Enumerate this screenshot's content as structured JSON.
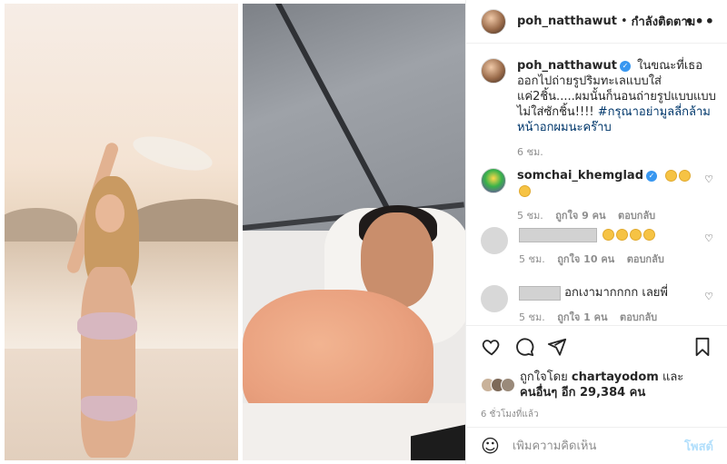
{
  "header": {
    "username": "poh_natthawut",
    "separator": "•",
    "follow_status": "กำลังติดตาม",
    "more_icon": "more-horizontal-icon"
  },
  "caption": {
    "username": "poh_natthawut",
    "text": "ในขณะที่เธอออกไปถ่ายรูปริมทะเลแบบใส่แค่2ชิ้น.....ผมนั้นก็นอนถ่ายรูปแบบแบบไม่ใส่ซักชิ้น!!!! ",
    "hashtag": "#กรุณาอย่ามูลลี่กล้ามหน้าอกผมนะคร๊าบ",
    "time": "6 ชม."
  },
  "comments": [
    {
      "username": "somchai_khemglad",
      "verified": true,
      "text": "",
      "emoji_count": 3,
      "time": "5 ชม.",
      "likes": "ถูกใจ 9 คน",
      "reply": "ตอบกลับ"
    },
    {
      "username": "",
      "text": "",
      "emoji_count": 4,
      "time": "5 ชม.",
      "likes": "ถูกใจ 10 คน",
      "reply": "ตอบกลับ"
    },
    {
      "username": "",
      "text": "อกเงามากกกก เลยพี่",
      "time": "5 ชม.",
      "likes": "ถูกใจ 1 คน",
      "reply": "ตอบกลับ"
    }
  ],
  "actions": {
    "icons": [
      "heart-icon",
      "comment-icon",
      "share-icon",
      "bookmark-icon"
    ],
    "liked_by_prefix": "ถูกใจโดย",
    "liked_by_user": "chartayodom",
    "liked_by_and": "และ",
    "liked_by_others": "คนอื่นๆ อีก 29,384 คน",
    "time": "6 ชั่วโมงที่แล้ว"
  },
  "add_comment": {
    "placeholder": "เพิ่มความคิดเห็น",
    "post_label": "โพสต์"
  },
  "colors": {
    "verified_blue": "#3897f0",
    "hashtag": "#00376b",
    "post_button_disabled": "#b2dffc",
    "meta_grey": "#8e8e8e"
  }
}
